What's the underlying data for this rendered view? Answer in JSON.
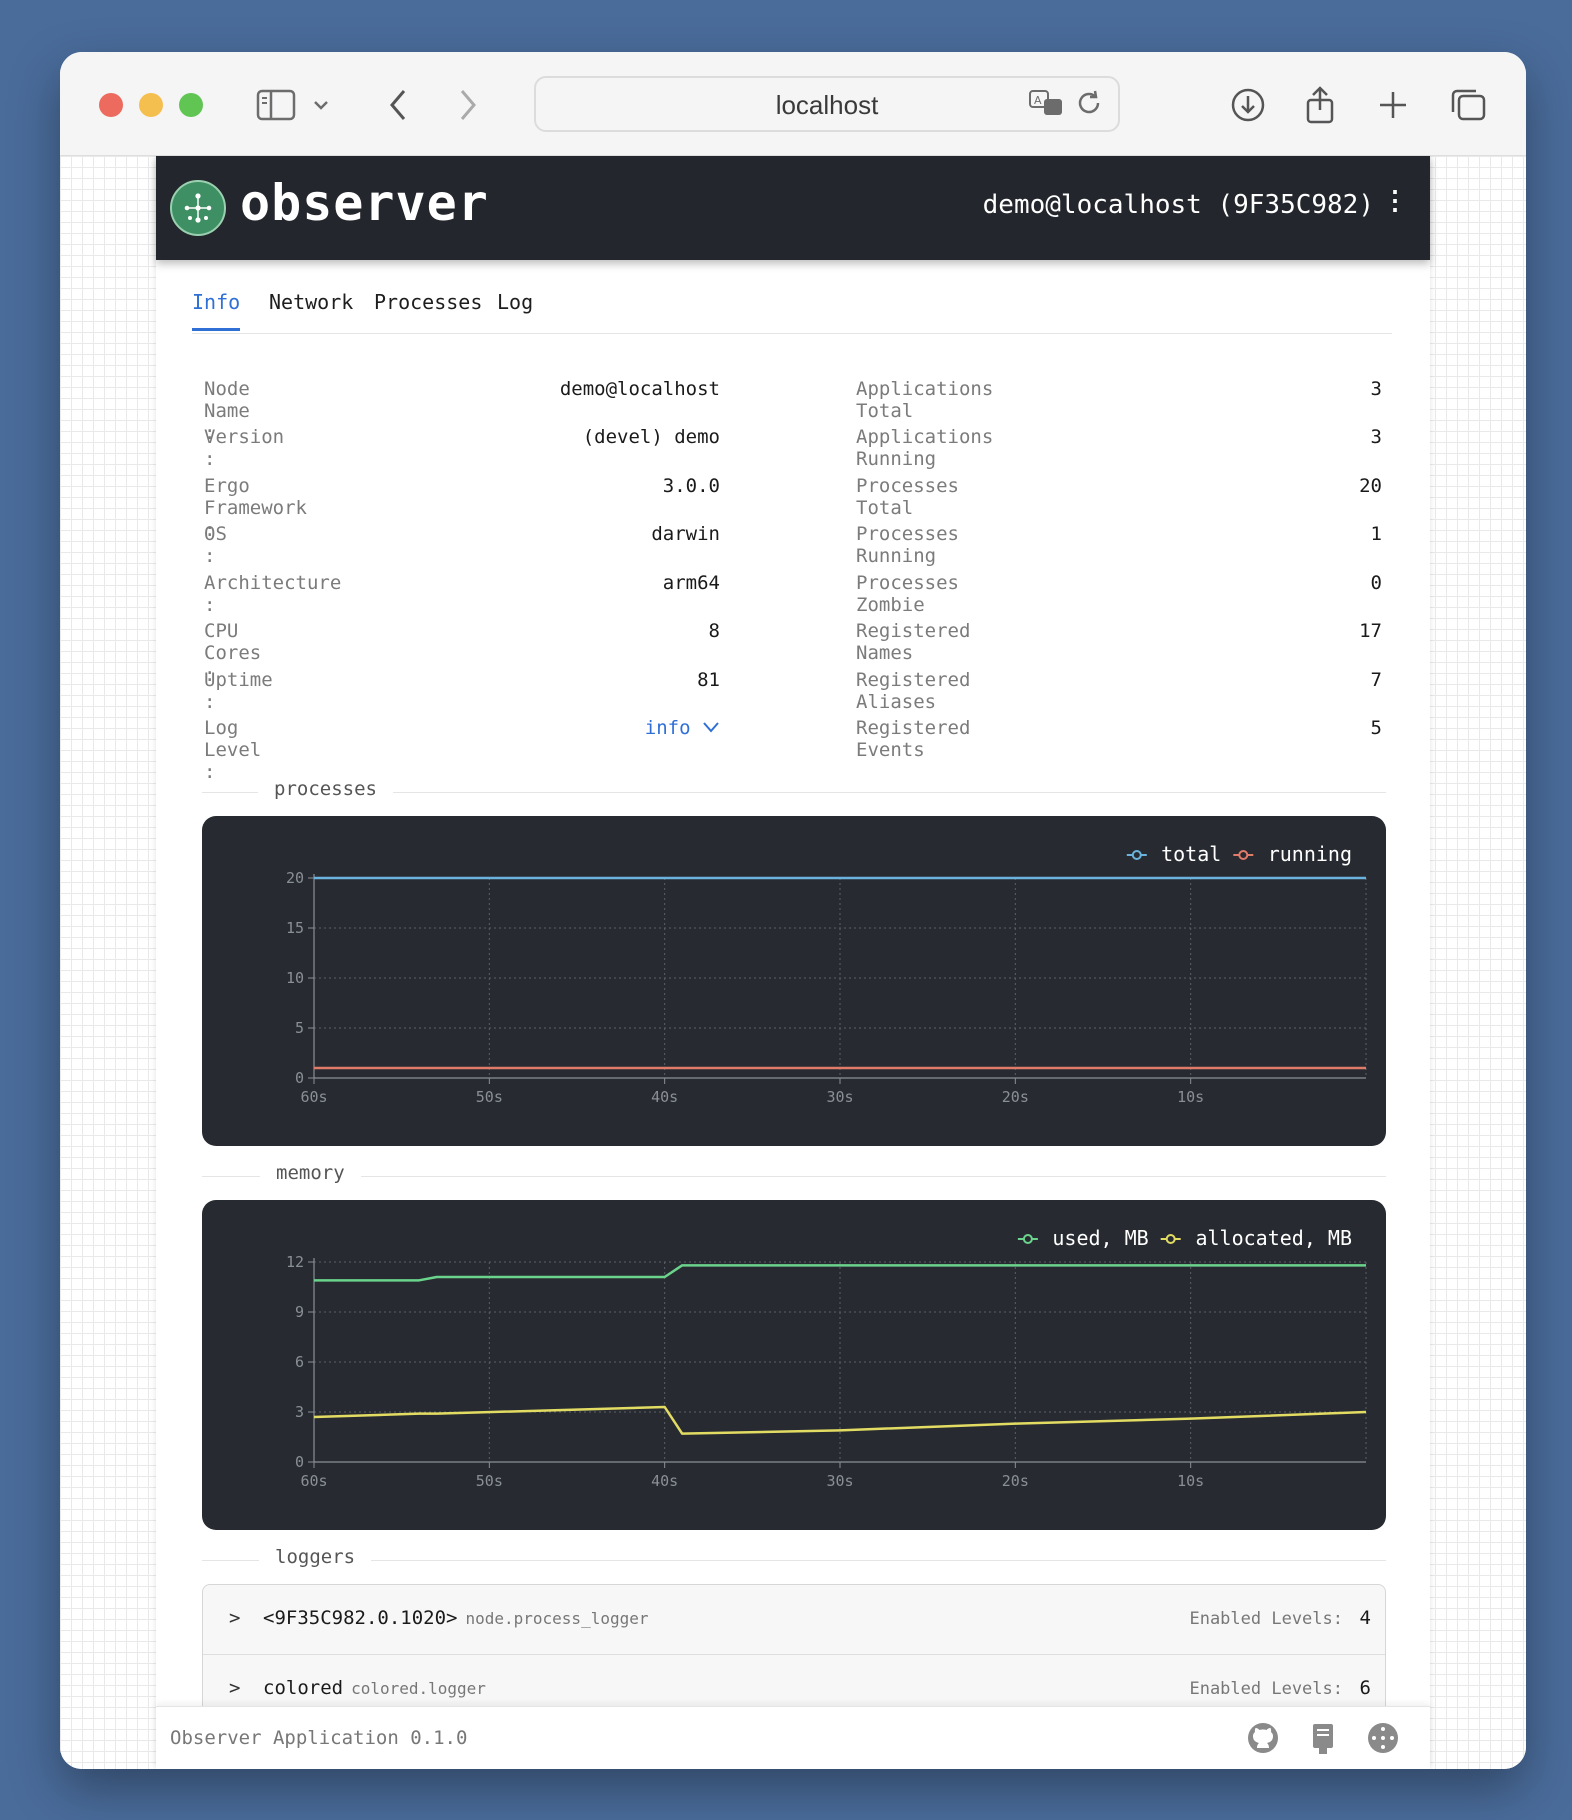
{
  "browser": {
    "url": "localhost"
  },
  "app": {
    "brand": "observer",
    "node_title": "demo@localhost (9F35C982)",
    "menu_icon": "more-vertical-icon"
  },
  "tabs": [
    {
      "label": "Info",
      "active": true
    },
    {
      "label": "Network",
      "active": false
    },
    {
      "label": "Processes",
      "active": false
    },
    {
      "label": "Log",
      "active": false
    }
  ],
  "node_info": [
    {
      "label": "Node Name",
      "value": "demo@localhost"
    },
    {
      "label": "Version",
      "value": "(devel) demo"
    },
    {
      "label": "Ergo Framework",
      "value": "3.0.0"
    },
    {
      "label": "OS",
      "value": "darwin"
    },
    {
      "label": "Architecture",
      "value": "arm64"
    },
    {
      "label": "CPU Cores",
      "value": "8"
    },
    {
      "label": "Uptime",
      "value": "81"
    },
    {
      "label": "Log Level",
      "value": "info"
    }
  ],
  "stats": [
    {
      "label": "Applications Total",
      "value": "3"
    },
    {
      "label": "Applications Running",
      "value": "3"
    },
    {
      "label": "Processes Total",
      "value": "20"
    },
    {
      "label": "Processes Running",
      "value": "1"
    },
    {
      "label": "Processes Zombie",
      "value": "0"
    },
    {
      "label": "Registered Names",
      "value": "17"
    },
    {
      "label": "Registered Aliases",
      "value": "7"
    },
    {
      "label": "Registered Events",
      "value": "5"
    }
  ],
  "sections": {
    "processes": "processes",
    "memory": "memory",
    "loggers": "loggers"
  },
  "chart_data": [
    {
      "type": "line",
      "title": "processes",
      "x": [
        60,
        50,
        40,
        30,
        20,
        10,
        0
      ],
      "x_tick_labels": [
        "60s",
        "50s",
        "40s",
        "30s",
        "20s",
        "10s"
      ],
      "y_ticks": [
        0,
        5,
        10,
        15,
        20
      ],
      "ylim": [
        0,
        20
      ],
      "grid": true,
      "legend": "top-right",
      "series": [
        {
          "name": "total",
          "color": "#6bb3de",
          "values": [
            20,
            20,
            20,
            20,
            20,
            20,
            20
          ]
        },
        {
          "name": "running",
          "color": "#e07b6a",
          "values": [
            1,
            1,
            1,
            1,
            1,
            1,
            1
          ]
        }
      ]
    },
    {
      "type": "line",
      "title": "memory",
      "x": [
        60,
        54,
        53,
        40,
        39,
        30,
        20,
        10,
        0
      ],
      "x_tick_labels": [
        "60s",
        "50s",
        "40s",
        "30s",
        "20s",
        "10s"
      ],
      "y_ticks": [
        0,
        3,
        6,
        9,
        12
      ],
      "ylim": [
        0,
        12
      ],
      "grid": true,
      "legend": "top-right",
      "series": [
        {
          "name": "used, MB",
          "color": "#6bd48c",
          "values": [
            10.9,
            10.9,
            11.1,
            11.1,
            11.8,
            11.8,
            11.8,
            11.8,
            11.8
          ]
        },
        {
          "name": "allocated, MB",
          "color": "#e3dc63",
          "values": [
            2.7,
            2.9,
            2.9,
            3.3,
            1.7,
            1.9,
            2.3,
            2.6,
            3.0
          ]
        }
      ]
    }
  ],
  "loggers": [
    {
      "name": "<9F35C982.0.1020>",
      "type": "node.process_logger",
      "levels_label": "Enabled Levels:",
      "levels": "4"
    },
    {
      "name": "colored",
      "type": "colored.logger",
      "levels_label": "Enabled Levels:",
      "levels": "6"
    }
  ],
  "footer": {
    "text": "Observer Application 0.1.0",
    "icons": [
      "github-icon",
      "book-icon",
      "ergo-logo-icon"
    ]
  }
}
